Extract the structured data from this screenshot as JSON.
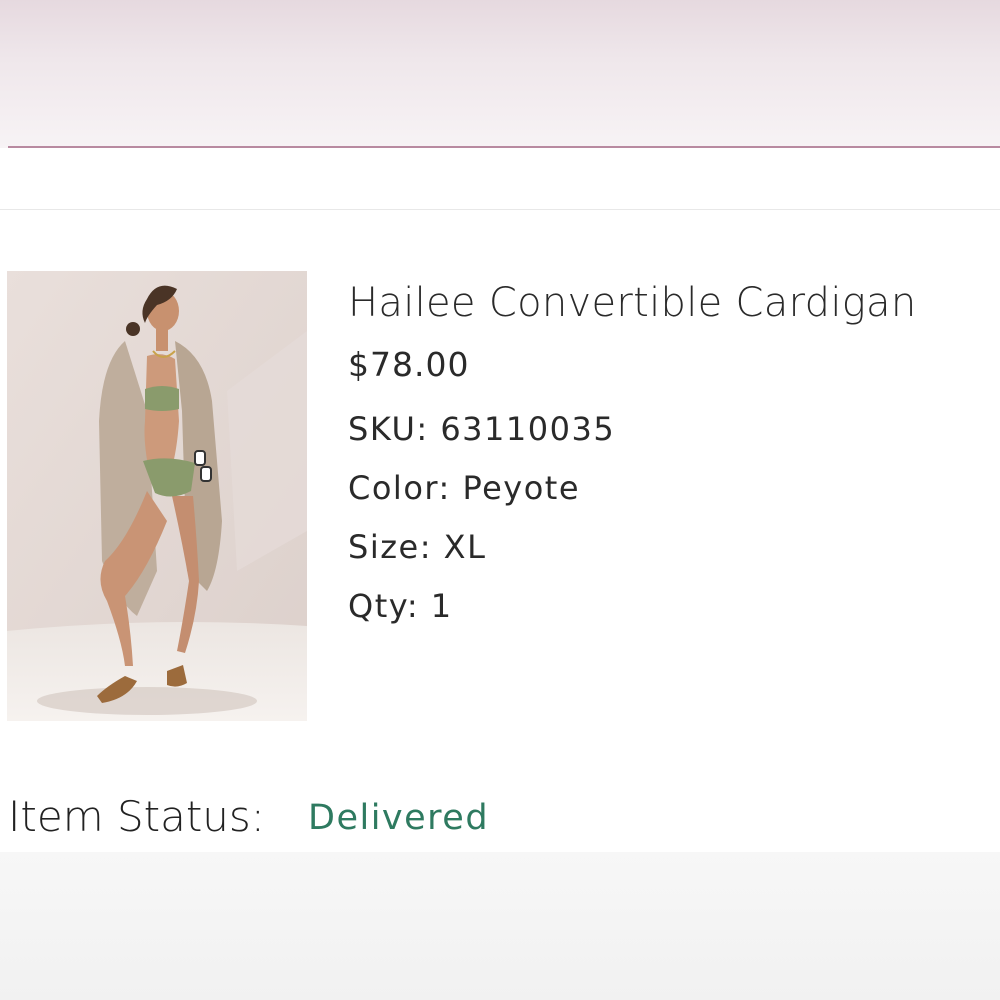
{
  "product": {
    "image_alt": "Model wearing a taupe long cardigan over a green bikini with lace-up sandals",
    "title": "Hailee Convertible Cardigan",
    "price": "$78.00",
    "sku_label": "SKU:",
    "sku_value": "63110035",
    "color_label": "Color:",
    "color_value": "Peyote",
    "size_label": "Size:",
    "size_value": "XL",
    "qty_label": "Qty:",
    "qty_value": "1"
  },
  "status": {
    "label": "Item Status:",
    "value": "Delivered"
  },
  "colors": {
    "status_green": "#2e7a60",
    "accent_line": "#b88aa0"
  }
}
